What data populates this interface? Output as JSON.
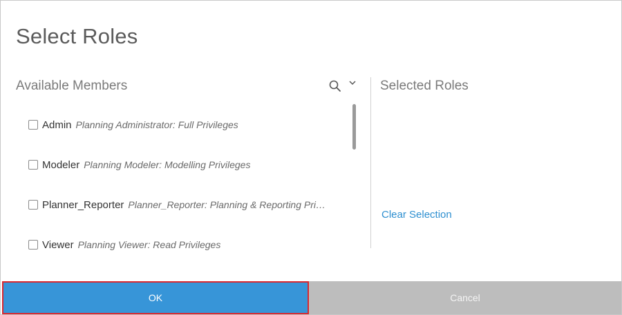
{
  "dialog": {
    "title": "Select Roles",
    "available_label": "Available Members",
    "selected_label": "Selected Roles",
    "clear_selection": "Clear Selection"
  },
  "icons": {
    "search": "search-icon",
    "expand": "chevron-down-icon"
  },
  "members": [
    {
      "name": "Admin",
      "description": "Planning Administrator: Full Privileges",
      "checked": false
    },
    {
      "name": "Modeler",
      "description": "Planning Modeler: Modelling Privileges",
      "checked": false
    },
    {
      "name": "Planner_Reporter",
      "description": "Planner_Reporter: Planning & Reporting Privil…",
      "checked": false
    },
    {
      "name": "Viewer",
      "description": "Planning Viewer: Read Privileges",
      "checked": false
    }
  ],
  "footer": {
    "ok_label": "OK",
    "cancel_label": "Cancel"
  },
  "colors": {
    "ok_background": "#3795d8",
    "ok_highlight_border": "#d9272e",
    "cancel_background": "#bdbdbd",
    "link": "#2d8fd0"
  }
}
